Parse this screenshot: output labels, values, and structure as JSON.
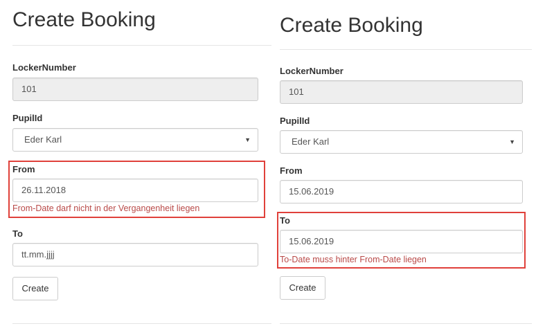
{
  "left": {
    "title": "Create Booking",
    "locker_label": "LockerNumber",
    "locker_value": "101",
    "pupil_label": "PupilId",
    "pupil_value": "Eder Karl",
    "from_label": "From",
    "from_value": "26.11.2018",
    "from_error": "From-Date darf nicht in der Vergangenheit liegen",
    "to_label": "To",
    "to_value": "tt.mm.jjjj",
    "create_label": "Create"
  },
  "right": {
    "title": "Create Booking",
    "locker_label": "LockerNumber",
    "locker_value": "101",
    "pupil_label": "PupilId",
    "pupil_value": "Eder Karl",
    "from_label": "From",
    "from_value": "15.06.2019",
    "to_label": "To",
    "to_value": "15.06.2019",
    "to_error": "To-Date muss hinter From-Date liegen",
    "create_label": "Create"
  },
  "icons": {
    "select_caret": "chevron-down-icon"
  },
  "colors": {
    "error_border": "#e0403a",
    "error_text": "#b94a48",
    "readonly_bg": "#eeeeee"
  }
}
